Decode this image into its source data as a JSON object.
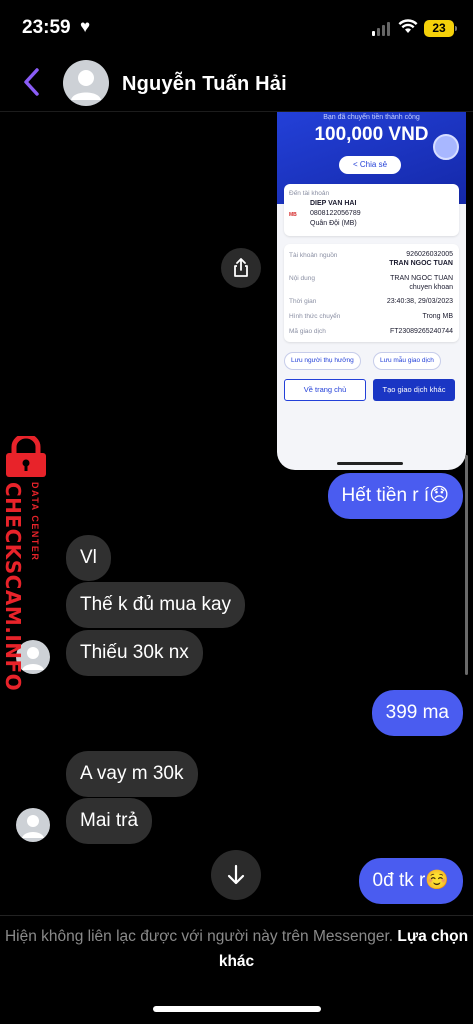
{
  "status_bar": {
    "time": "23:59",
    "battery": "23"
  },
  "header": {
    "contact_name": "Nguyễn Tuấn Hải"
  },
  "receipt": {
    "success_text": "Bạn đã chuyển tiền thành công",
    "amount": "100,000 VND",
    "share_label": "Chia sẻ",
    "to_account_label": "Đến tài khoản",
    "recipient_name": "DIEP VAN HAI",
    "recipient_account": "0808122056789",
    "recipient_bank": "Quân Đội (MB)",
    "bank_logo": "MB",
    "source_account_label": "Tài khoản nguồn",
    "source_account": "926026032005",
    "sender_name": "TRAN NGOC TUAN",
    "content_label": "Nội dung",
    "content_line1": "TRAN NGOC TUAN",
    "content_line2": "chuyen khoan",
    "time_label": "Thời gian",
    "time_value": "23:40:38, 29/03/2023",
    "method_label": "Hình thức chuyển",
    "method_value": "Trong MB",
    "txn_label": "Mã giao dịch",
    "txn_value": "FT23089265240744",
    "save_recipient": "Lưu người thụ hưởng",
    "save_template": "Lưu mẫu giao dịch",
    "home_button": "Về trang chủ",
    "new_txn_button": "Tạo giao dịch khác"
  },
  "messages": [
    {
      "side": "out",
      "text": "Hết tiền r í😞"
    },
    {
      "side": "in",
      "text": "Vl"
    },
    {
      "side": "in",
      "text": "Thế k đủ mua kay"
    },
    {
      "side": "in",
      "text": "Thiếu 30k nx"
    },
    {
      "side": "out",
      "text": "399 ma"
    },
    {
      "side": "in",
      "text": "A vay m 30k"
    },
    {
      "side": "in",
      "text": "Mai trả"
    },
    {
      "side": "out",
      "text": "0đ tk r☺️"
    }
  ],
  "watermark": {
    "main": "CHECKSCAM.INFO",
    "sub": "DATA CENTER"
  },
  "footer": {
    "notice": "Hiện không liên lạc được với người này trên Messenger.",
    "action": "Lựa chọn khác"
  }
}
